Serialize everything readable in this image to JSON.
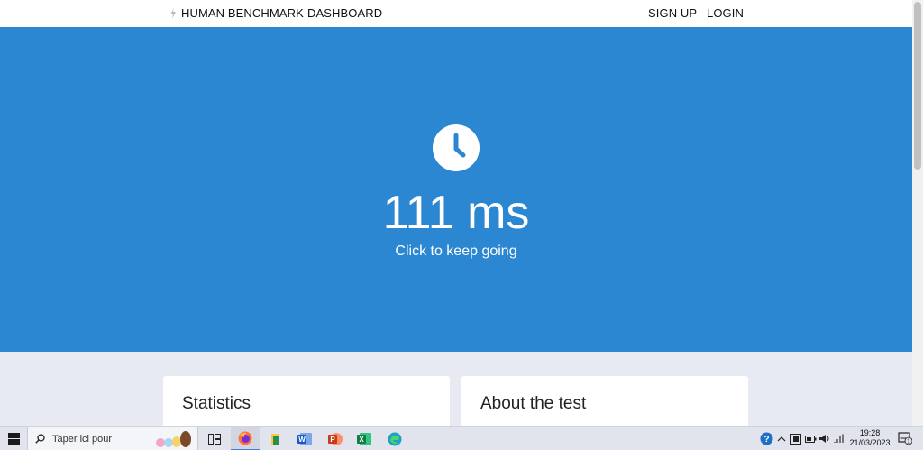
{
  "nav": {
    "brand": "HUMAN BENCHMARK",
    "dashboard": "DASHBOARD",
    "signup": "SIGN UP",
    "login": "LOGIN"
  },
  "hero": {
    "result": "111 ms",
    "subtitle": "Click to keep going",
    "icon": "clock-icon",
    "background_color": "#2b87d1"
  },
  "cards": {
    "stats_title": "Statistics",
    "about_title": "About the test"
  },
  "taskbar": {
    "search_placeholder": "Taper ici pour",
    "time": "19:28",
    "date": "21/03/2023",
    "notification_count": "1",
    "apps": [
      "task-view-icon",
      "firefox-icon",
      "file-explorer-icon",
      "word-icon",
      "powerpoint-icon",
      "excel-icon",
      "edge-icon"
    ]
  }
}
